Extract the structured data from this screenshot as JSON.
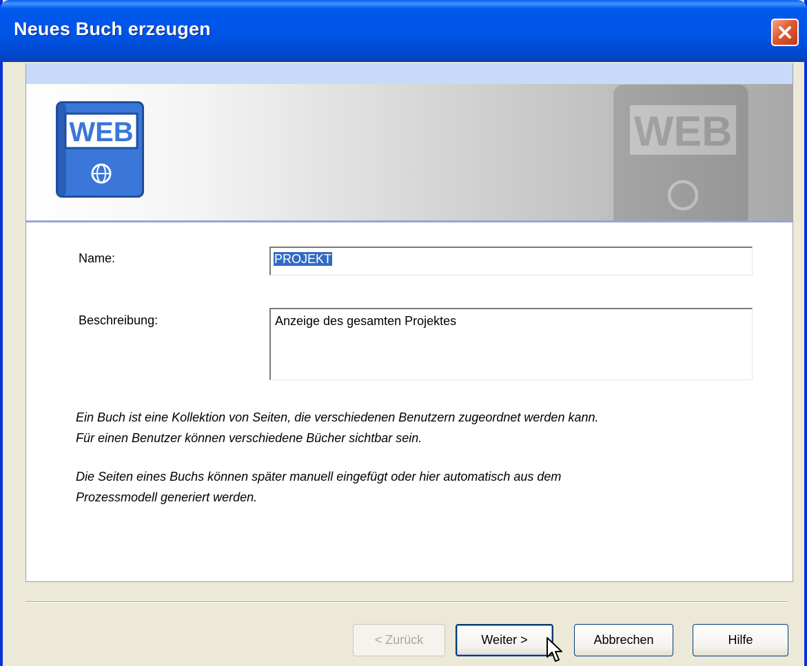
{
  "window": {
    "title": "Neues Buch erzeugen"
  },
  "icons": {
    "book_label": "WEB",
    "book_icon": "web-book-icon",
    "close_icon": "close-icon",
    "cursor_icon": "mouse-pointer-icon"
  },
  "form": {
    "name_label": "Name:",
    "name_value": "PROJEKT",
    "description_label": "Beschreibung:",
    "description_value": "Anzeige des gesamten Projektes"
  },
  "info": {
    "p1_line1": "Ein Buch ist eine Kollektion von Seiten, die verschiedenen Benutzern zugeordnet werden kann.",
    "p1_line2": "Für einen Benutzer können verschiedene Bücher sichtbar sein.",
    "p2_line1": "Die Seiten eines Buchs können später manuell eingefügt oder hier automatisch aus dem",
    "p2_line2": "Prozessmodell generiert werden."
  },
  "buttons": {
    "back": "< Zurück",
    "next": "Weiter >",
    "cancel": "Abbrechen",
    "help": "Hilfe"
  },
  "colors": {
    "titlebar": "#0055e5",
    "selection": "#316ac5",
    "book_blue": "#3a77d8",
    "dialog_bg": "#ece9d8"
  }
}
